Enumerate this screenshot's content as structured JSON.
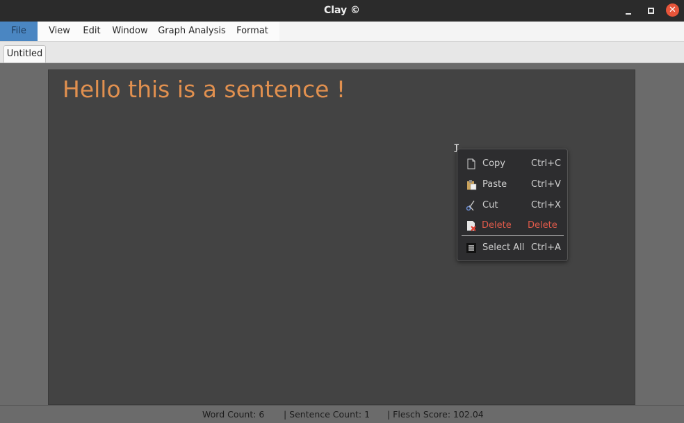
{
  "window": {
    "title": "Clay ©",
    "close_glyph": "✕"
  },
  "menubar": {
    "items": [
      "File",
      "View",
      "Edit",
      "Window",
      "Graph Analysis",
      "Format"
    ],
    "active": "File"
  },
  "tabs": [
    {
      "label": "Untitled",
      "active": true
    }
  ],
  "document": {
    "text": "Hello this is a sentence !",
    "text_color": "#e1904f"
  },
  "context_menu": {
    "items": [
      {
        "label": "Copy",
        "shortcut": "Ctrl+C",
        "icon": "copy-icon"
      },
      {
        "label": "Paste",
        "shortcut": "Ctrl+V",
        "icon": "paste-icon"
      },
      {
        "label": "Cut",
        "shortcut": "Ctrl+X",
        "icon": "cut-icon"
      },
      {
        "label": "Delete",
        "shortcut": "Delete",
        "icon": "delete-icon",
        "danger": true
      },
      {
        "label": "Select All",
        "shortcut": "Ctrl+A",
        "icon": "select-all-icon"
      }
    ],
    "danger_color": "#e05a4a"
  },
  "statusbar": {
    "word_count": "Word Count: 6",
    "sentence_count": "| Sentence Count: 1",
    "flesch_score": "| Flesch Score: 102.04"
  }
}
